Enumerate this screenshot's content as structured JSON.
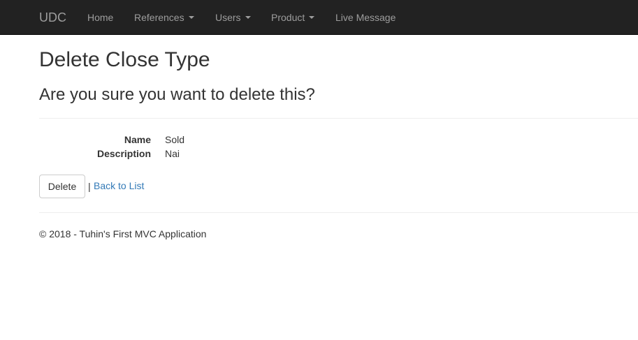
{
  "navbar": {
    "brand": "UDC",
    "items": [
      {
        "label": "Home",
        "dropdown": false
      },
      {
        "label": "References",
        "dropdown": true
      },
      {
        "label": "Users",
        "dropdown": true
      },
      {
        "label": "Product",
        "dropdown": true
      },
      {
        "label": "Live Message",
        "dropdown": false
      }
    ]
  },
  "main": {
    "title": "Delete Close Type",
    "confirm_question": "Are you sure you want to delete this?",
    "details": [
      {
        "label": "Name",
        "value": "Sold"
      },
      {
        "label": "Description",
        "value": "Nai"
      }
    ],
    "delete_label": "Delete",
    "separator": "|",
    "back_link": "Back to List"
  },
  "footer": {
    "text": "© 2018 - Tuhin's First MVC Application"
  },
  "colors": {
    "navbar_bg": "#222222",
    "navbar_text": "#9d9d9d",
    "link": "#337ab7",
    "text": "#333333"
  }
}
